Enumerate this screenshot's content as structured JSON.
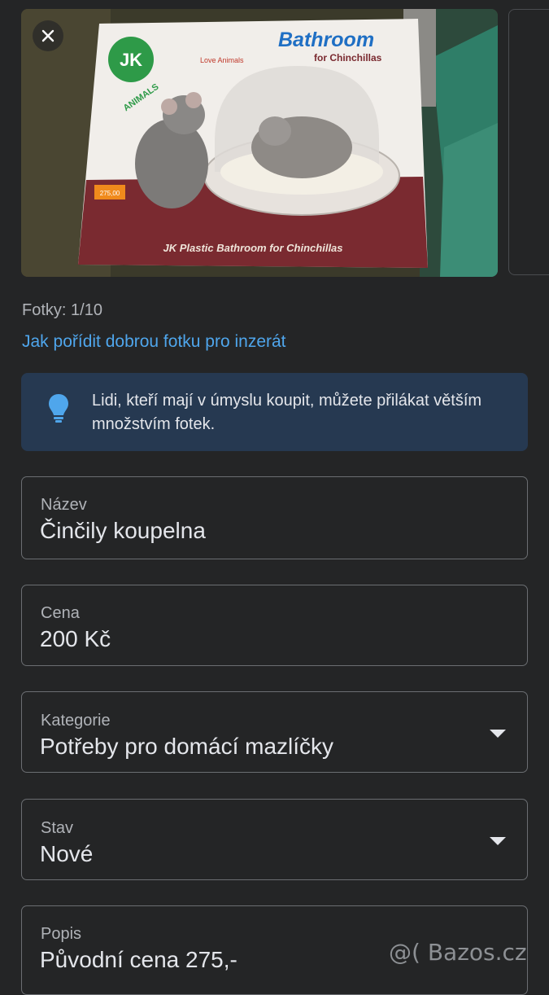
{
  "photos": {
    "counter_text": "Fotky: 1/10",
    "help_link": "Jak pořídit dobrou fotku pro inzerát",
    "box_print": {
      "logo": "JK",
      "logo_sub": "ANIMALS",
      "love_badge": "Love Animals",
      "title": "Bathroom",
      "subtitle": "for Chinchillas",
      "footer": "JK Plastic Bathroom for Chinchillas",
      "price_sticker": "275,00"
    }
  },
  "tip": {
    "text": "Lidi, kteří mají v úmyslu koupit, můžete přilákat větším množstvím fotek.",
    "icon": "lightbulb-icon"
  },
  "fields": {
    "title": {
      "label": "Název",
      "value": "Činčily koupelna"
    },
    "price": {
      "label": "Cena",
      "value": "200 Kč"
    },
    "category": {
      "label": "Kategorie",
      "value": "Potřeby pro domácí mazlíčky"
    },
    "condition": {
      "label": "Stav",
      "value": "Nové"
    },
    "description": {
      "label": "Popis",
      "value": "Původní cena 275,-"
    }
  },
  "watermark": "@( Bazos.cz",
  "colors": {
    "background": "#242526",
    "link": "#4fa6ec",
    "tip_background": "#263951",
    "field_border": "#6b6e72"
  }
}
